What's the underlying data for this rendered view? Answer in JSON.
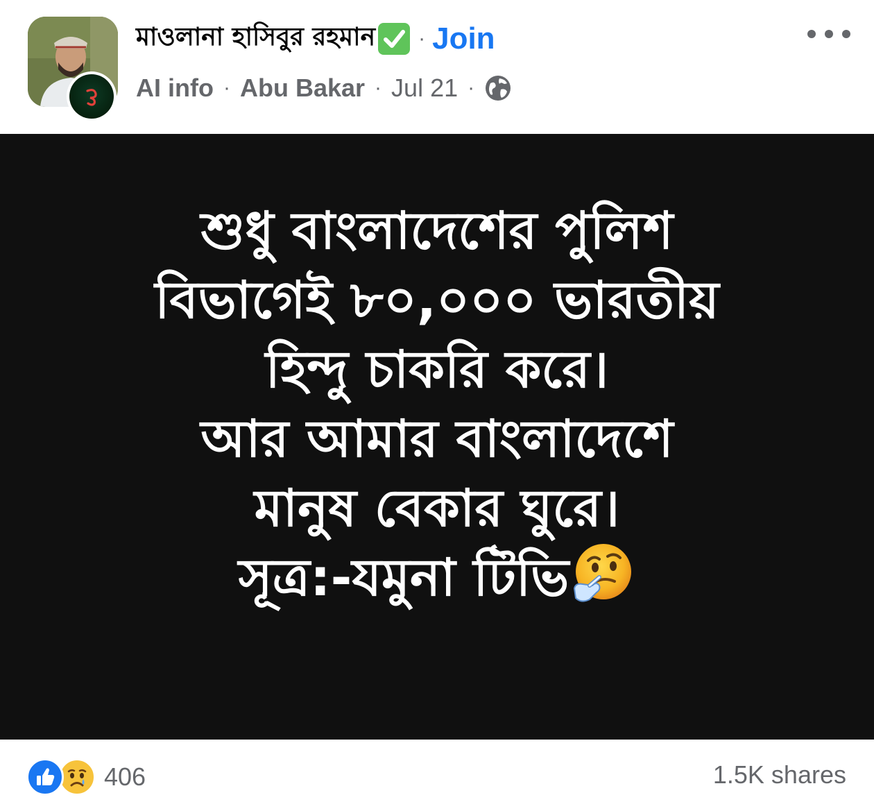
{
  "header": {
    "page_name": "মাওলানা হাসিবুর রহমান",
    "verified_icon": "check-mark-button-emoji",
    "dot": "·",
    "join_label": "Join",
    "meta": {
      "ai_info": "AI info",
      "author": "Abu Bakar",
      "date": "Jul 21",
      "separator": "·",
      "audience_icon": "globe-icon"
    },
    "more_icon": "more-options-icon"
  },
  "post": {
    "background": "#101010",
    "lines": [
      "শুধু বাংলাদেশের পুলিশ",
      "বিভাগেই ৮০,০০০ ভারতীয়",
      "হিন্দু চাকরি করে।",
      "আর আমার বাংলাদেশে",
      "মানুষ বেকার ঘুরে।",
      "সূত্র:-যমুনা টিভি"
    ],
    "trailing_emoji": "thinking-face-emoji"
  },
  "footer": {
    "reaction_icons": [
      "like-icon",
      "sad-icon"
    ],
    "reaction_count": "406",
    "shares": "1.5K shares"
  },
  "colors": {
    "accent": "#1877f2",
    "secondary_text": "#65676b",
    "verified_green": "#5fc45a"
  }
}
